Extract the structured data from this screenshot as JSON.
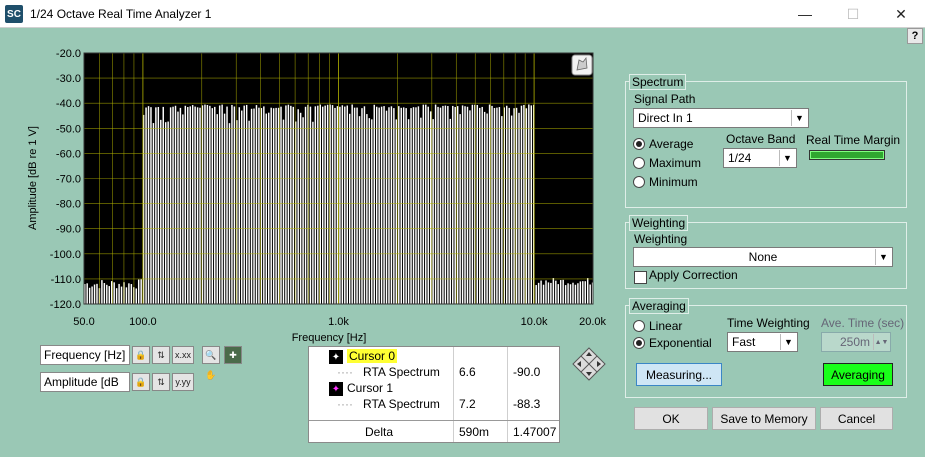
{
  "window": {
    "title": "1/24 Octave Real Time Analyzer 1",
    "app_icon": "SC",
    "help_label": "?"
  },
  "chart_data": {
    "type": "bar",
    "title": "",
    "xlabel": "Frequency [Hz]",
    "ylabel": "Amplitude [dB re 1 V]",
    "x_scale": "log",
    "xlim": [
      50,
      20000
    ],
    "ylim": [
      -120,
      -20
    ],
    "x_ticks": [
      "50.0",
      "100.0",
      "1.0k",
      "10.0k",
      "20.0k"
    ],
    "y_ticks": [
      "-20.0",
      "-30.0",
      "-40.0",
      "-50.0",
      "-60.0",
      "-70.0",
      "-80.0",
      "-90.0",
      "-100.0",
      "-110.0",
      "-120.0"
    ],
    "grid": true,
    "colors": {
      "background": "#000000",
      "bars": "#ffffff",
      "grid": "#b4b400"
    },
    "series": [
      {
        "bands_per_octave": 24,
        "f_start": 50,
        "f_end": 20000,
        "floor_level_low": -112,
        "floor_level_high": -111,
        "passband_level": -42,
        "passband_start": 100,
        "passband_end": 10000
      }
    ]
  },
  "scales": {
    "x_name": "Frequency [Hz]",
    "y_name": "Amplitude [dB"
  },
  "cursors": {
    "rows": [
      {
        "name": "Cursor 0",
        "x": "",
        "y": ""
      },
      {
        "name": "RTA Spectrum",
        "x": "6.6",
        "y": "-90.0"
      },
      {
        "name": "Cursor 1",
        "x": "",
        "y": ""
      },
      {
        "name": "RTA Spectrum",
        "x": "7.2",
        "y": "-88.3"
      }
    ],
    "delta": {
      "name": "Delta",
      "x": "590m",
      "y": "1.47007"
    }
  },
  "spectrum": {
    "title": "Spectrum",
    "signal_path_label": "Signal Path",
    "signal_path_value": "Direct In 1",
    "modes": [
      "Average",
      "Maximum",
      "Minimum"
    ],
    "selected_mode": "Average",
    "octave_band_label": "Octave Band",
    "octave_band_value": "1/24",
    "rt_margin_label": "Real Time Margin"
  },
  "weighting": {
    "title": "Weighting",
    "label": "Weighting",
    "value": "None",
    "apply_correction_label": "Apply Correction"
  },
  "averaging": {
    "title": "Averaging",
    "modes": [
      "Linear",
      "Exponential"
    ],
    "selected_mode": "Exponential",
    "time_weighting_label": "Time Weighting",
    "time_weighting_value": "Fast",
    "ave_time_label": "Ave. Time (sec)",
    "ave_time_value": "250m",
    "measuring_label": "Measuring...",
    "averaging_label": "Averaging"
  },
  "buttons": {
    "ok": "OK",
    "save": "Save to Memory",
    "cancel": "Cancel"
  }
}
